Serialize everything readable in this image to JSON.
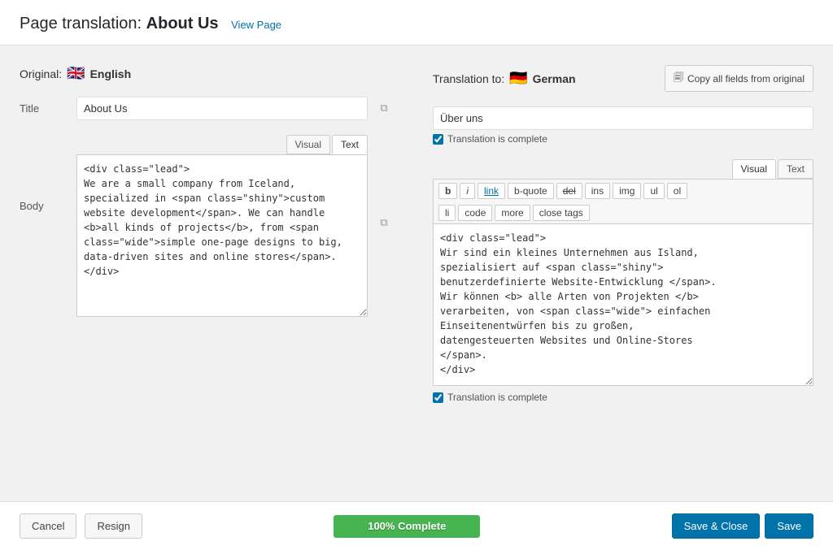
{
  "header": {
    "prefix": "Page translation:",
    "page_title": "About Us",
    "view_page_link": "View Page"
  },
  "original": {
    "column_header_prefix": "Original:",
    "flag": "🇬🇧",
    "language": "English"
  },
  "translation": {
    "column_header_prefix": "Translation to:",
    "flag": "🇩🇪",
    "language": "German",
    "copy_button_label": "Copy all fields from original"
  },
  "title_field": {
    "label": "Title",
    "original_value": "About Us",
    "translated_value": "Über uns",
    "translation_complete_label": "Translation is complete"
  },
  "body_field": {
    "label": "Body",
    "original_value": "<div class=\"lead\">\nWe are a small company from Iceland,\nspecialized in <span class=\"shiny\">custom\nwebsite development</span>. We can handle\n<b>all kinds of projects</b>, from <span\nclass=\"wide\">simple one-page designs to big,\ndata-driven sites and online stores</span>.\n</div>",
    "translated_value": "<div class=\"lead\">\nWir sind ein kleines Unternehmen aus Island,\nspezialisiert auf <span class=\"shiny\">\nbenutzerdefinierte Website-Entwicklung </span>.\nWir können <b> alle Arten von Projekten </b>\nverarbeiten, von <span class=\"wide\"> einfachen\nEinseitenentwürfen bis zu großen,\ndatengesteuerten Websites und Online-Stores\n</span>.\n</div>",
    "translation_complete_label": "Translation is complete",
    "tabs": {
      "visual_label": "Visual",
      "text_label": "Text"
    },
    "toolbar_buttons": [
      "b",
      "i",
      "link",
      "b-quote",
      "del",
      "ins",
      "img",
      "ul",
      "ol"
    ],
    "toolbar_row2_buttons": [
      "li",
      "code",
      "more",
      "close tags"
    ]
  },
  "footer": {
    "cancel_label": "Cancel",
    "resign_label": "Resign",
    "progress_label": "100% Complete",
    "progress_percent": 100,
    "save_close_label": "Save & Close",
    "save_label": "Save"
  },
  "icons": {
    "copy": "⧉",
    "copy_doc": "🗐"
  }
}
